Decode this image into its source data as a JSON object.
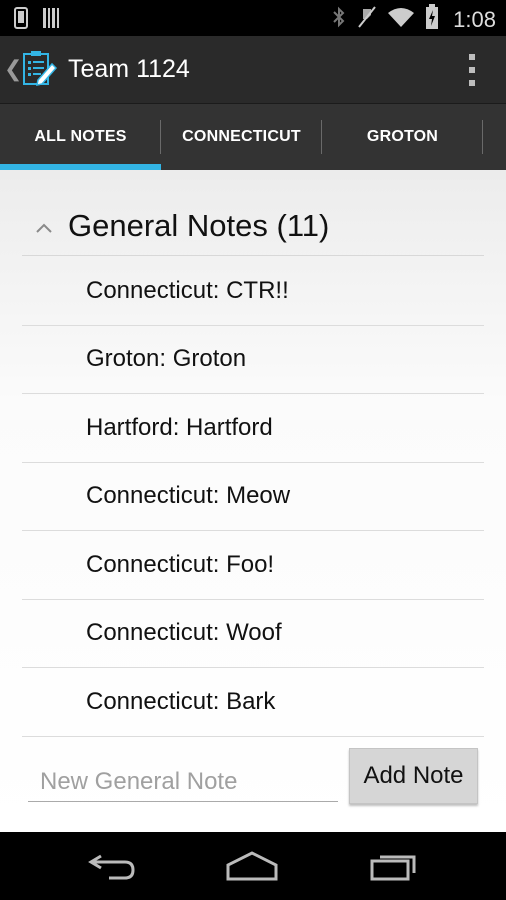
{
  "status_bar": {
    "time": "1:08",
    "icons": [
      "phone-icon",
      "barcode-icon",
      "bluetooth-icon",
      "muted-icon",
      "wifi-icon",
      "battery-icon"
    ]
  },
  "action_bar": {
    "title": "Team 1124",
    "app_icon": "notes-icon",
    "up_icon": "chevron-left-icon",
    "overflow_icon": "overflow-menu-icon"
  },
  "tabs": [
    {
      "label": "ALL NOTES",
      "selected": true
    },
    {
      "label": "CONNECTICUT",
      "selected": false
    },
    {
      "label": "GROTON",
      "selected": false
    }
  ],
  "group": {
    "title": "General Notes (11)",
    "expanded": true
  },
  "notes": [
    "Connecticut: CTR!!",
    "Groton: Groton",
    "Hartford: Hartford",
    "Connecticut: Meow",
    "Connecticut: Foo!",
    "Connecticut: Woof",
    "Connecticut: Bark"
  ],
  "add_note": {
    "placeholder": "New General Note",
    "value": "",
    "button_label": "Add Note"
  },
  "colors": {
    "accent": "#33b5e5",
    "tab_bar": "#333333",
    "action_bar": "#2a2a2a"
  },
  "nav_bar": {
    "icons": [
      "back-icon",
      "home-icon",
      "recent-apps-icon"
    ]
  }
}
